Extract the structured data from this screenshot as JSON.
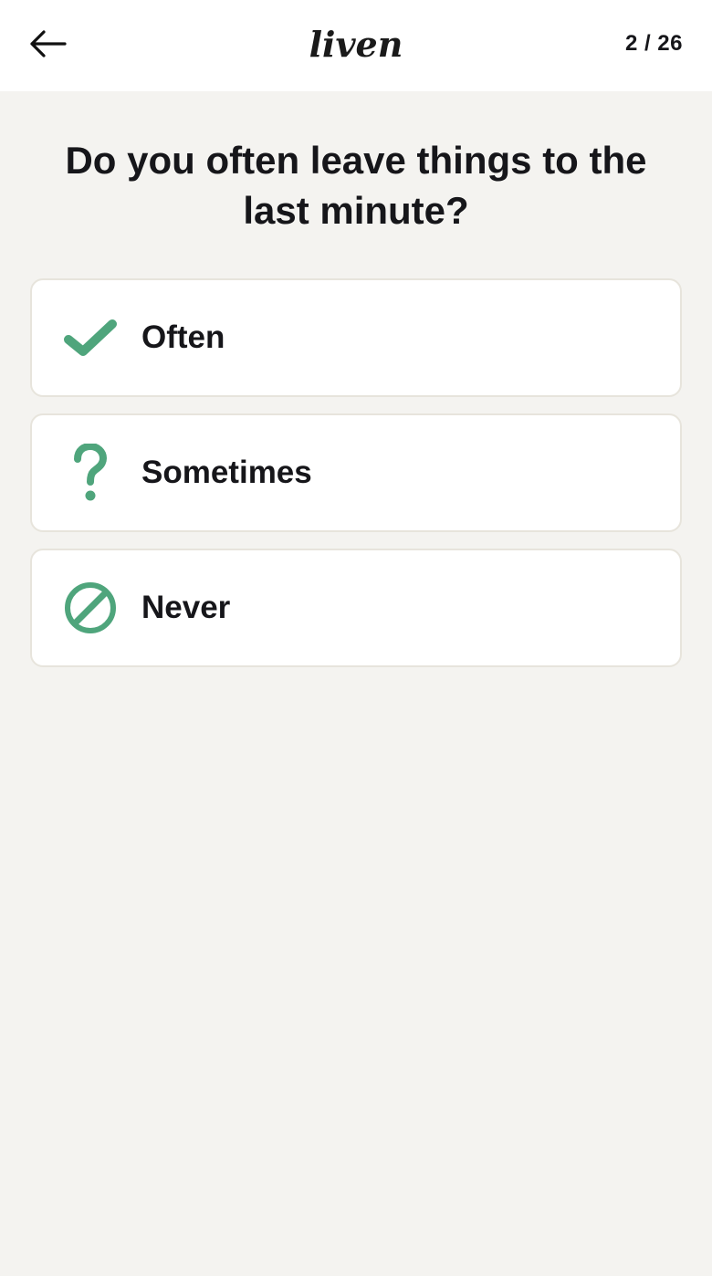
{
  "header": {
    "back_icon": "arrow-left-icon",
    "logo_text": "liven",
    "progress": "2 / 26"
  },
  "question": {
    "text": "Do you often leave things to the last minute?"
  },
  "options": [
    {
      "label": "Often",
      "icon": "checkmark-icon"
    },
    {
      "label": "Sometimes",
      "icon": "question-mark-icon"
    },
    {
      "label": "Never",
      "icon": "prohibited-icon"
    }
  ],
  "colors": {
    "accent": "#4fa57c",
    "background": "#f4f3f0",
    "card": "#ffffff",
    "card_border": "#e7e4dc",
    "text": "#16161a"
  }
}
